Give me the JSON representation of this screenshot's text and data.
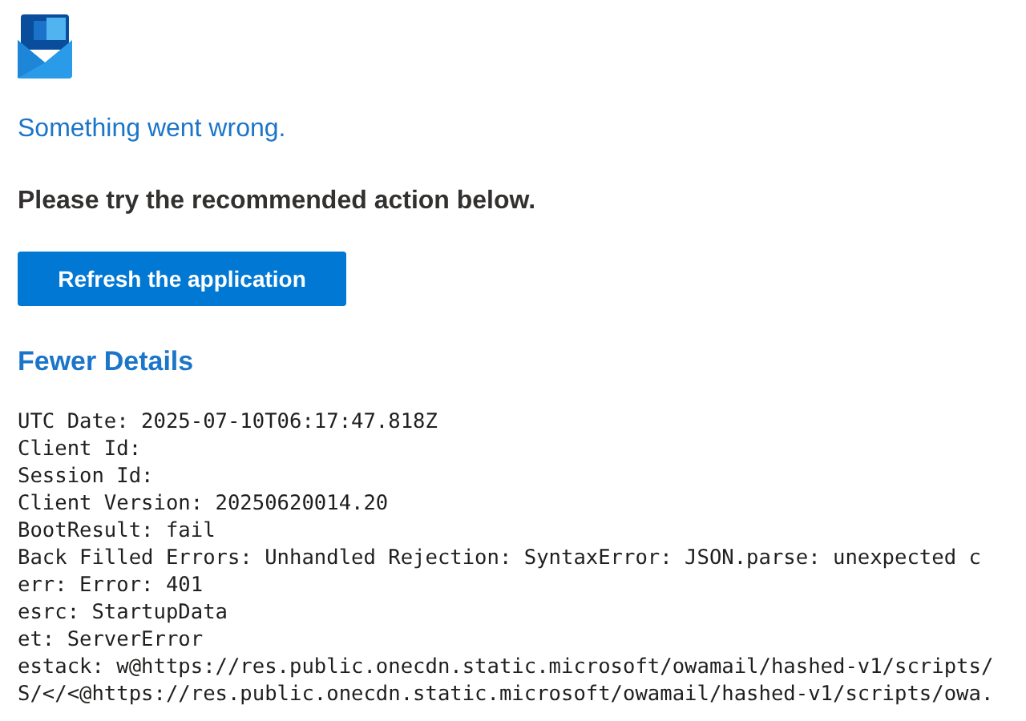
{
  "heading": "Something went wrong.",
  "message": "Please try the recommended action below.",
  "action_button": "Refresh the application",
  "details_toggle": "Fewer Details",
  "details_lines": [
    "UTC Date: 2025-07-10T06:17:47.818Z",
    "Client Id:",
    "Session Id:",
    "Client Version: 20250620014.20",
    "BootResult: fail",
    "Back Filled Errors: Unhandled Rejection: SyntaxError: JSON.parse: unexpected c",
    "err: Error: 401",
    "esrc: StartupData",
    "et: ServerError",
    "estack: w@https://res.public.onecdn.static.microsoft/owamail/hashed-v1/scripts/",
    "S/</<@https://res.public.onecdn.static.microsoft/owamail/hashed-v1/scripts/owa."
  ]
}
